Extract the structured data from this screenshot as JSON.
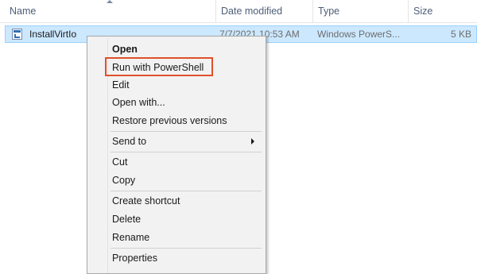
{
  "columns": {
    "name": "Name",
    "date": "Date modified",
    "type": "Type",
    "size": "Size"
  },
  "file": {
    "name": "InstallVirtIo",
    "date": "7/7/2021 10:53 AM",
    "type": "Windows PowerS...",
    "size": "5 KB",
    "icon": "powershell-script-icon"
  },
  "menu": {
    "open": "Open",
    "run_powershell": "Run with PowerShell",
    "edit": "Edit",
    "open_with": "Open with...",
    "restore": "Restore previous versions",
    "send_to": "Send to",
    "cut": "Cut",
    "copy": "Copy",
    "create_shortcut": "Create shortcut",
    "delete": "Delete",
    "rename": "Rename",
    "properties": "Properties"
  },
  "colors": {
    "selection_bg": "#cce8ff",
    "highlight_border": "#e0502a"
  }
}
